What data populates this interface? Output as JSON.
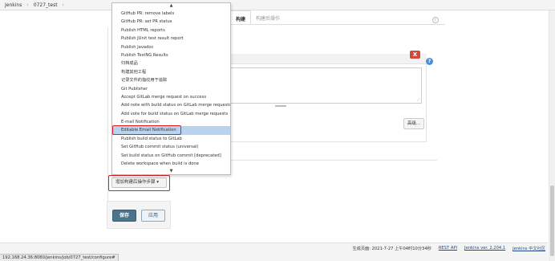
{
  "breadcrumb": {
    "items": [
      "Jenkins",
      "0727_test"
    ],
    "separator": "›"
  },
  "tabs": [
    {
      "label": "构建",
      "active": true
    },
    {
      "label": "构建后操作",
      "active": false
    }
  ],
  "dropdown": {
    "scroll_up": "▲",
    "scroll_down": "▼",
    "items": [
      "GitHub PR: remove labels",
      "GitHub PR: set PR status",
      "Publish HTML reports",
      "Publish JUnit test result report",
      "Publish Javadoc",
      "Publish TestNG Results",
      "归档成品",
      "构建其他工程",
      "记录文件的指纹用于追踪",
      "Git Publisher",
      "Accept GitLab merge request on success",
      "Add note with build status on GitLab merge requests",
      "Add vote for build status on GitLab merge requests",
      "E-mail Notification",
      "Editable Email Notification",
      "Publish build status to GitLab",
      "Set GitHub commit status (universal)",
      "Set build status on GitHub commit [deprecated]",
      "Delete workspace when build is done"
    ],
    "selected_index": 14
  },
  "panel": {
    "delete_label": "X",
    "help_label": "?",
    "advanced_label": "高级..."
  },
  "add_post_build_label": "增加构建后操作步骤 ▾",
  "actions": {
    "save_label": "保存",
    "apply_label": "应用"
  },
  "footer": {
    "status_url": "192.168.24.36:8080/jenkins/job/0727_test/configure#",
    "generated": "生成页面: 2021-7-27 上午04时10分34秒",
    "rest_api": "REST API",
    "version": "Jenkins ver. 2.204.1",
    "community": "Jenkins 中文社区"
  },
  "colors": {
    "accent_red": "#e02020",
    "save_button": "#4b758b",
    "selection": "#b9d3ee"
  }
}
